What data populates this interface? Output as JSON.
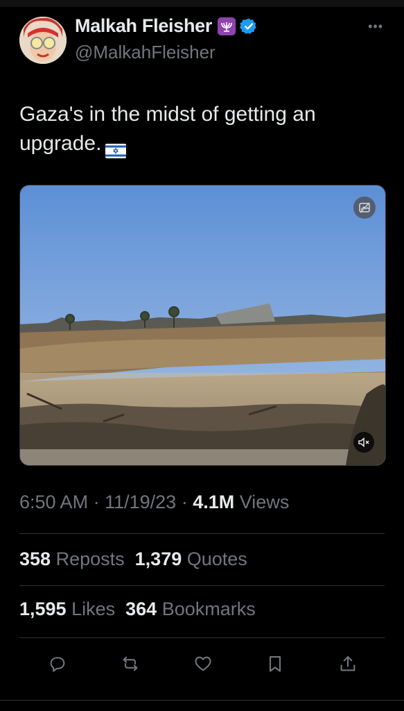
{
  "author": {
    "name": "Malkah Fleisher",
    "handle": "@MalkahFleisher",
    "badge_emoji": "menorah",
    "verified": true
  },
  "tweet": {
    "text": "Gaza's in the midst of getting an upgrade.",
    "flag": "israel-flag"
  },
  "media": {
    "type": "video",
    "ai_badge_icon": "ai-image-icon",
    "mute_icon": "muted-speaker-icon"
  },
  "meta": {
    "time": "6:50 AM",
    "sep1": "·",
    "date": "11/19/23",
    "sep2": "·",
    "views_count": "4.1M",
    "views_label": "Views"
  },
  "stats": {
    "reposts_count": "358",
    "reposts_label": "Reposts",
    "quotes_count": "1,379",
    "quotes_label": "Quotes",
    "likes_count": "1,595",
    "likes_label": "Likes",
    "bookmarks_count": "364",
    "bookmarks_label": "Bookmarks"
  },
  "actions": [
    "reply-icon",
    "repost-icon",
    "like-icon",
    "bookmark-icon",
    "share-icon"
  ],
  "colors": {
    "background": "#000000",
    "primary_text": "#e7e9ea",
    "secondary_text": "#71767b",
    "divider": "#2f3336",
    "verified_blue": "#1d9bf0",
    "badge_purple": "#8e44ad"
  }
}
